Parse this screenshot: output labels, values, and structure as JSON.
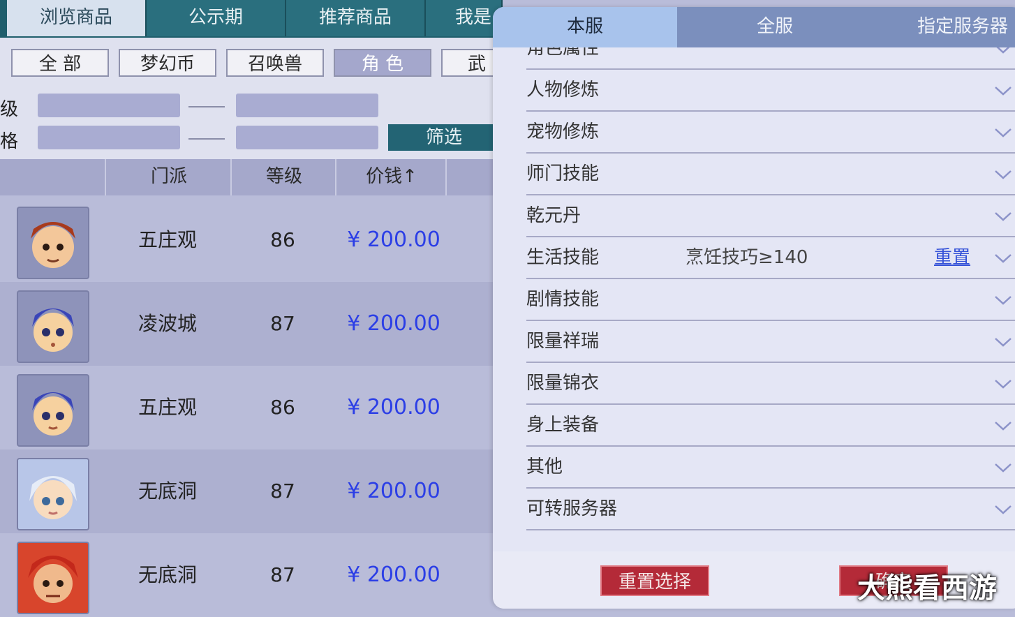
{
  "top_tabs": [
    "浏览商品",
    "公示期",
    "推荐商品",
    "我是"
  ],
  "categories": [
    "全 部",
    "梦幻币",
    "召唤兽",
    "角 色",
    "武"
  ],
  "filters": {
    "level_label": "级",
    "price_label": "格",
    "filter_button": "筛选"
  },
  "table": {
    "headers": [
      "门派",
      "等级",
      "价钱↑"
    ],
    "rows": [
      {
        "sect": "五庄观",
        "level": "86",
        "price": "¥ 200.00",
        "avatar_icon": "character-portrait-icon"
      },
      {
        "sect": "凌波城",
        "level": "87",
        "price": "¥ 200.00",
        "avatar_icon": "character-portrait-icon"
      },
      {
        "sect": "五庄观",
        "level": "86",
        "price": "¥ 200.00",
        "avatar_icon": "character-portrait-icon"
      },
      {
        "sect": "无底洞",
        "level": "87",
        "price": "¥ 200.00",
        "avatar_icon": "character-portrait-icon"
      },
      {
        "sect": "无底洞",
        "level": "87",
        "price": "¥ 200.00",
        "avatar_icon": "character-portrait-icon"
      }
    ]
  },
  "panel": {
    "tabs": [
      "本服",
      "全服",
      "指定服务器"
    ],
    "items": [
      {
        "label": "角色属性",
        "value": "",
        "reset": ""
      },
      {
        "label": "人物修炼",
        "value": "",
        "reset": ""
      },
      {
        "label": "宠物修炼",
        "value": "",
        "reset": ""
      },
      {
        "label": "师门技能",
        "value": "",
        "reset": ""
      },
      {
        "label": "乾元丹",
        "value": "",
        "reset": ""
      },
      {
        "label": "生活技能",
        "value": "烹饪技巧≥140",
        "reset": "重置"
      },
      {
        "label": "剧情技能",
        "value": "",
        "reset": ""
      },
      {
        "label": "限量祥瑞",
        "value": "",
        "reset": ""
      },
      {
        "label": "限量锦衣",
        "value": "",
        "reset": ""
      },
      {
        "label": "身上装备",
        "value": "",
        "reset": ""
      },
      {
        "label": "其他",
        "value": "",
        "reset": ""
      },
      {
        "label": "可转服务器",
        "value": "",
        "reset": ""
      }
    ],
    "footer": {
      "reset_selection": "重置选择",
      "confirm": "确定"
    }
  },
  "watermark": "大熊看西游",
  "colors": {
    "teal_bar": "#1f5e6c",
    "price_blue": "#2b3ee6",
    "footer_button_red": "#b42a38",
    "panel_tab_active": "#a8c3ec"
  }
}
